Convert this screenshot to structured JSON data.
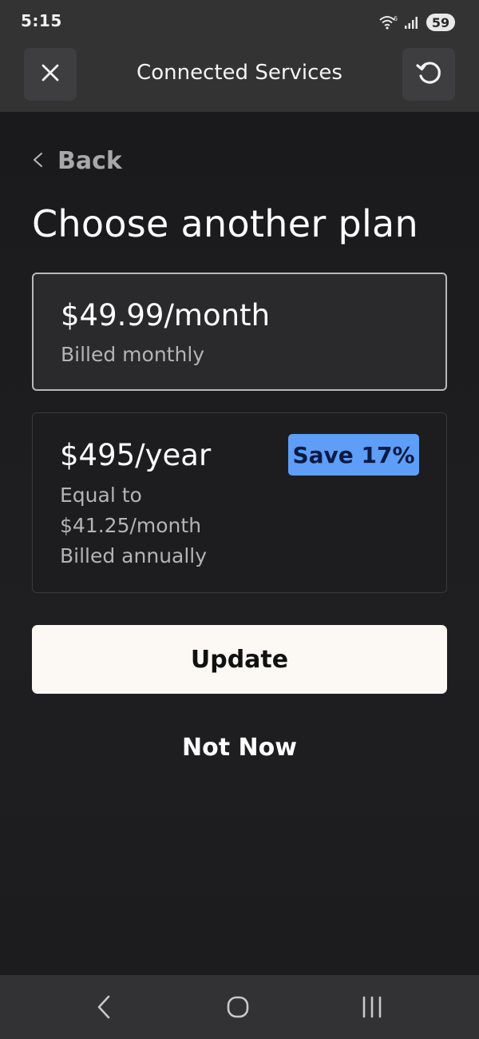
{
  "status_bar": {
    "time": "5:15",
    "battery": "59",
    "icons": [
      "wifi-icon",
      "signal-icon"
    ]
  },
  "app_bar": {
    "title": "Connected Services",
    "close_icon": "close-icon",
    "refresh_icon": "refresh-icon"
  },
  "back": {
    "label": "Back",
    "icon": "chevron-left-icon"
  },
  "page_title": "Choose another plan",
  "plans": [
    {
      "price": "$49.99/month",
      "details": [
        "Billed monthly"
      ],
      "selected": true
    },
    {
      "price": "$495/year",
      "details": [
        "Equal to",
        "$41.25/month",
        "Billed annually"
      ],
      "badge": "Save 17%",
      "selected": false
    }
  ],
  "actions": {
    "update_label": "Update",
    "not_now_label": "Not Now"
  },
  "nav_bar": {
    "icons": [
      "nav-back-icon",
      "nav-home-icon",
      "nav-recents-icon"
    ]
  },
  "colors": {
    "background": "#1c1c1e",
    "bar": "#333334",
    "badge": "#5e9ef7",
    "badge_text": "#0a1a44",
    "primary_button": "#fcf8f4"
  }
}
